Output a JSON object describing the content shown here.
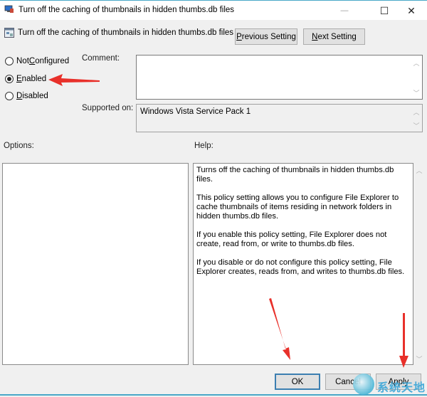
{
  "window": {
    "title": "Turn off the caching of thumbnails in hidden thumbs.db files",
    "minimize_glyph": "—",
    "maximize_glyph": "☐",
    "close_glyph": "✕"
  },
  "header": {
    "policy_name": "Turn off the caching of thumbnails in hidden thumbs.db files",
    "previous_setting": {
      "accel": "P",
      "rest": "revious Setting"
    },
    "next_setting": {
      "accel": "N",
      "rest": "ext Setting"
    }
  },
  "state": {
    "options": [
      {
        "accel": "",
        "pre": "Not ",
        "accel2": "C",
        "rest": "onfigured",
        "selected": false
      },
      {
        "accel": "E",
        "pre": "",
        "accel2": "",
        "rest": "nabled",
        "selected": true
      },
      {
        "accel": "D",
        "pre": "",
        "accel2": "",
        "rest": "isabled",
        "selected": false
      }
    ]
  },
  "comment": {
    "label": "Comment:",
    "value": ""
  },
  "supported_on": {
    "label": "Supported on:",
    "value": "Windows Vista Service Pack 1"
  },
  "options_label": "Options:",
  "help": {
    "label": "Help:",
    "paragraphs": [
      "Turns off the caching of thumbnails in hidden thumbs.db files.",
      "This policy setting allows you to configure File Explorer to cache thumbnails of items residing in network folders in hidden thumbs.db files.",
      "If you enable this policy setting, File Explorer does not create, read from, or write to thumbs.db files.",
      "If you disable or do not configure this policy setting, File Explorer creates, reads from, and writes to thumbs.db files."
    ]
  },
  "footer": {
    "ok": "OK",
    "cancel": "Cancel",
    "apply": "Apply"
  },
  "annotations": {
    "arrow_color": "#e8302a",
    "watermark_text": "系统天地"
  }
}
